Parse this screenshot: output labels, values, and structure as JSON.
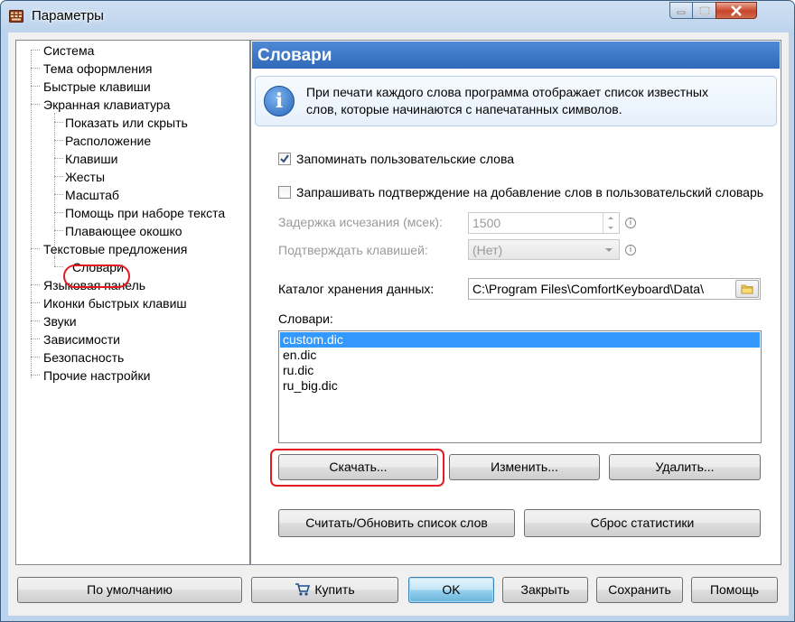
{
  "window": {
    "title": "Параметры"
  },
  "tree": {
    "items": [
      {
        "label": "Система"
      },
      {
        "label": "Тема оформления"
      },
      {
        "label": "Быстрые клавиши"
      },
      {
        "label": "Экранная клавиатура"
      },
      {
        "label": "Показать или скрыть"
      },
      {
        "label": "Расположение"
      },
      {
        "label": "Клавиши"
      },
      {
        "label": "Жесты"
      },
      {
        "label": "Масштаб"
      },
      {
        "label": "Помощь при наборе текста"
      },
      {
        "label": "Плавающее окошко"
      },
      {
        "label": "Текстовые предложения"
      },
      {
        "label": "Словари"
      },
      {
        "label": "Языковая панель"
      },
      {
        "label": "Иконки быстрых клавиш"
      },
      {
        "label": "Звуки"
      },
      {
        "label": "Зависимости"
      },
      {
        "label": "Безопасность"
      },
      {
        "label": "Прочие настройки"
      }
    ],
    "selected": "Словари"
  },
  "panel": {
    "title": "Словари",
    "info_line1": "При печати каждого слова программа отображает список известных",
    "info_line2": "слов, которые начинаются с напечатанных символов.",
    "remember_label": "Запоминать пользовательские слова",
    "remember_checked": true,
    "confirm_label": "Запрашивать подтверждение на добавление слов в пользовательский словарь",
    "confirm_checked": false,
    "delay_label": "Задержка исчезания (мсек):",
    "delay_value": "1500",
    "confirm_key_label": "Подтверждать клавишей:",
    "confirm_key_value": "(Нет)",
    "catalog_label": "Каталог хранения данных:",
    "catalog_path": "C:\\Program Files\\ComfortKeyboard\\Data\\",
    "dicts_label": "Словари:",
    "dictionaries": [
      "custom.dic",
      "en.dic",
      "ru.dic",
      "ru_big.dic"
    ],
    "selected_dictionary": "custom.dic",
    "download_btn": "Скачать...",
    "edit_btn": "Изменить...",
    "delete_btn": "Удалить...",
    "refresh_btn": "Считать/Обновить список слов",
    "reset_stats_btn": "Сброс статистики"
  },
  "footer": {
    "defaults_btn": "По умолчанию",
    "buy_btn": "Купить",
    "ok_btn": "OK",
    "close_btn": "Закрыть",
    "save_btn": "Сохранить",
    "help_btn": "Помощь"
  },
  "colors": {
    "accent": "#3270c0",
    "highlight_ring": "#e21b22",
    "selection": "#3399ff"
  }
}
